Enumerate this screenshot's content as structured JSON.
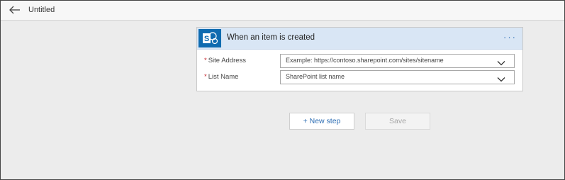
{
  "header": {
    "back_icon": "arrow-left-icon",
    "title": "Untitled"
  },
  "trigger_card": {
    "icon": "sharepoint-icon",
    "brand_color": "#0f6bb0",
    "title": "When an item is created",
    "more_label": "···",
    "fields": [
      {
        "label": "Site Address",
        "required_mark": "*",
        "placeholder": "Example: https://contoso.sharepoint.com/sites/sitename"
      },
      {
        "label": "List Name",
        "required_mark": "*",
        "placeholder": "SharePoint list name"
      }
    ]
  },
  "actions": {
    "new_step_label": "+ New step",
    "save_label": "Save"
  }
}
